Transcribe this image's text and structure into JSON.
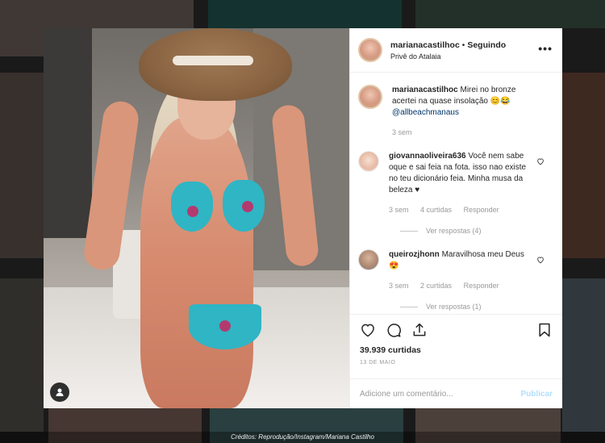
{
  "post": {
    "username": "marianacastilhoc",
    "separator": "•",
    "follow_status": "Seguindo",
    "location": "Privê do Atalaia",
    "more_icon": "more-horizontal-icon"
  },
  "caption": {
    "username": "marianacastilhoc",
    "text": "Mirei no bronze acertei na quase insolação 😊😂",
    "mention": "@allbeachmanaus",
    "time": "3 sem"
  },
  "comments": [
    {
      "username": "giovannaoliveira636",
      "text": "Você nem sabe oque e sai feia na fota. isso nao existe no teu dicionário feia. Minha musa da beleza ♥",
      "time": "3 sem",
      "likes": "4 curtidas",
      "reply": "Responder",
      "view_replies": "Ver respostas (4)"
    },
    {
      "username": "queirozjhonn",
      "text": "Maravilhosa meu Deus😍",
      "time": "3 sem",
      "likes": "2 curtidas",
      "reply": "Responder",
      "view_replies": "Ver respostas (1)"
    }
  ],
  "stats": {
    "likes": "39.939 curtidas",
    "date": "13 DE MAIO"
  },
  "add_comment": {
    "placeholder": "Adicione um comentário...",
    "post_label": "Publicar"
  },
  "credit": "Créditos: Reprodução/Instagram/Mariana Castilho",
  "colors": {
    "link": "#003569",
    "publish_disabled": "#b2dffc",
    "bikini": "#2fb5c4"
  }
}
